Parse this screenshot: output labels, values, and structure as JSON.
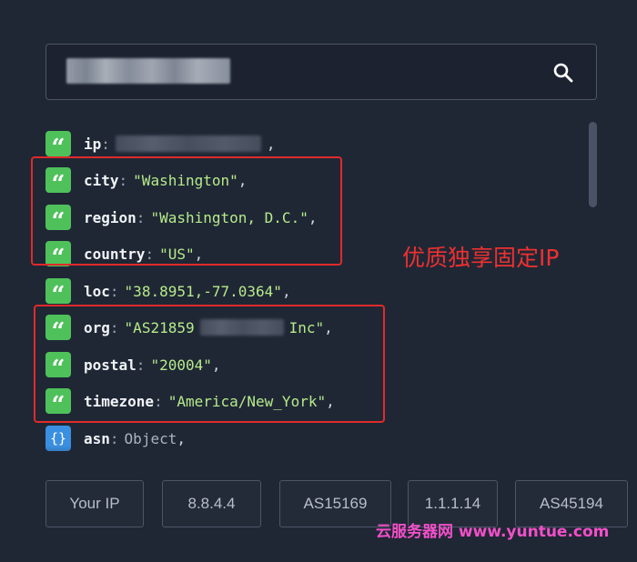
{
  "search": {
    "value": "",
    "icon": "search-icon"
  },
  "fields": [
    {
      "key": "ip",
      "value": "",
      "comma": ","
    },
    {
      "key": "city",
      "value": "\"Washington\"",
      "comma": ","
    },
    {
      "key": "region",
      "value": "\"Washington, D.C.\"",
      "comma": ","
    },
    {
      "key": "country",
      "value": "\"US\"",
      "comma": ","
    },
    {
      "key": "loc",
      "value": "\"38.8951,-77.0364\"",
      "comma": ","
    },
    {
      "key": "org",
      "value_prefix": "\"AS21859",
      "value_suffix": "Inc\"",
      "comma": ","
    },
    {
      "key": "postal",
      "value": "\"20004\"",
      "comma": ","
    },
    {
      "key": "timezone",
      "value": "\"America/New_York\"",
      "comma": ","
    },
    {
      "key": "asn",
      "value": "Object",
      "comma": ","
    }
  ],
  "badges": {
    "string_icon": "quote-icon",
    "object_icon": "braces-icon",
    "string_glyph": "“",
    "object_glyph": "{}"
  },
  "annotation": "优质独享固定IP",
  "chips": [
    "Your IP",
    "8.8.4.4",
    "AS15169",
    "1.1.1.14",
    "AS45194"
  ],
  "watermark": "云服务器网 www.yuntue.com",
  "colors": {
    "string_value": "#b7ea8a",
    "highlight": "#e02a2a",
    "string_badge": "#4fc15b",
    "object_badge": "#3b8fe0",
    "watermark": "#f24fc8"
  }
}
